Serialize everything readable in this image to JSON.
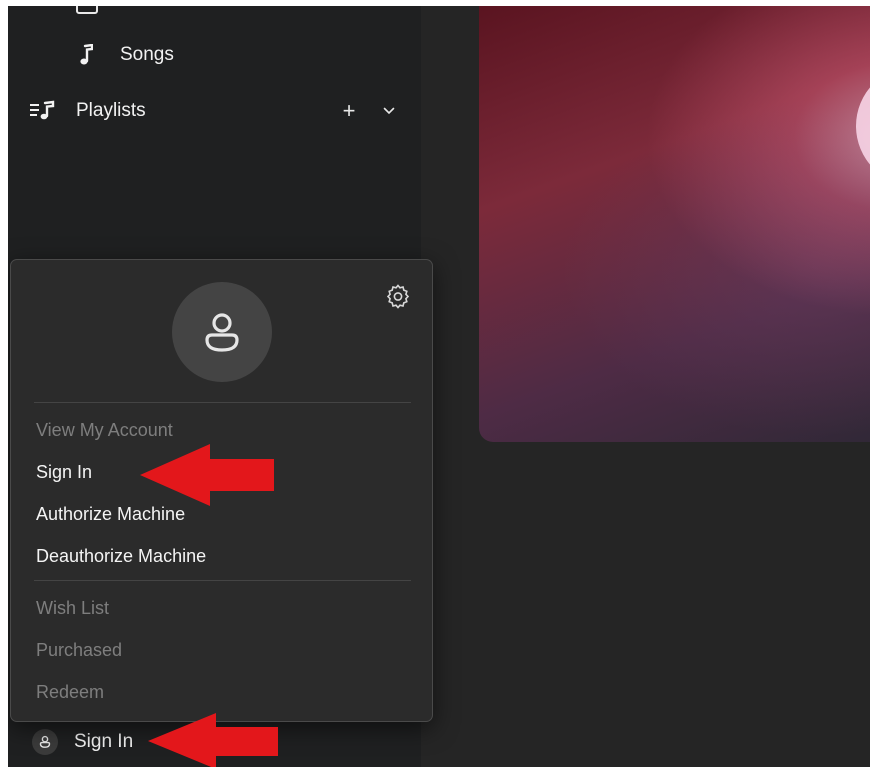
{
  "sidebar": {
    "items": [
      {
        "label": "Songs",
        "icon": "music-note-icon"
      },
      {
        "label": "Playlists",
        "icon": "playlist-icon",
        "actions": [
          "add-icon",
          "chevron-down-icon"
        ]
      }
    ],
    "add_label": "+"
  },
  "account_menu": {
    "icon": "gear-icon",
    "avatar_icon": "person-icon",
    "items": [
      {
        "label": "View My Account",
        "enabled": false
      },
      {
        "label": "Sign In",
        "enabled": true
      },
      {
        "label": "Authorize Machine",
        "enabled": true
      },
      {
        "label": "Deauthorize Machine",
        "enabled": true
      },
      {
        "label": "Wish List",
        "enabled": false
      },
      {
        "label": "Purchased",
        "enabled": false
      },
      {
        "label": "Redeem",
        "enabled": false
      }
    ]
  },
  "footer": {
    "sign_in_label": "Sign In",
    "avatar_icon": "person-icon"
  },
  "colors": {
    "sidebar_bg": "#1f2021",
    "popover_bg": "#2b2b2b",
    "annotation_arrow": "#e3171b",
    "disabled_text": "#7e7e7e"
  }
}
